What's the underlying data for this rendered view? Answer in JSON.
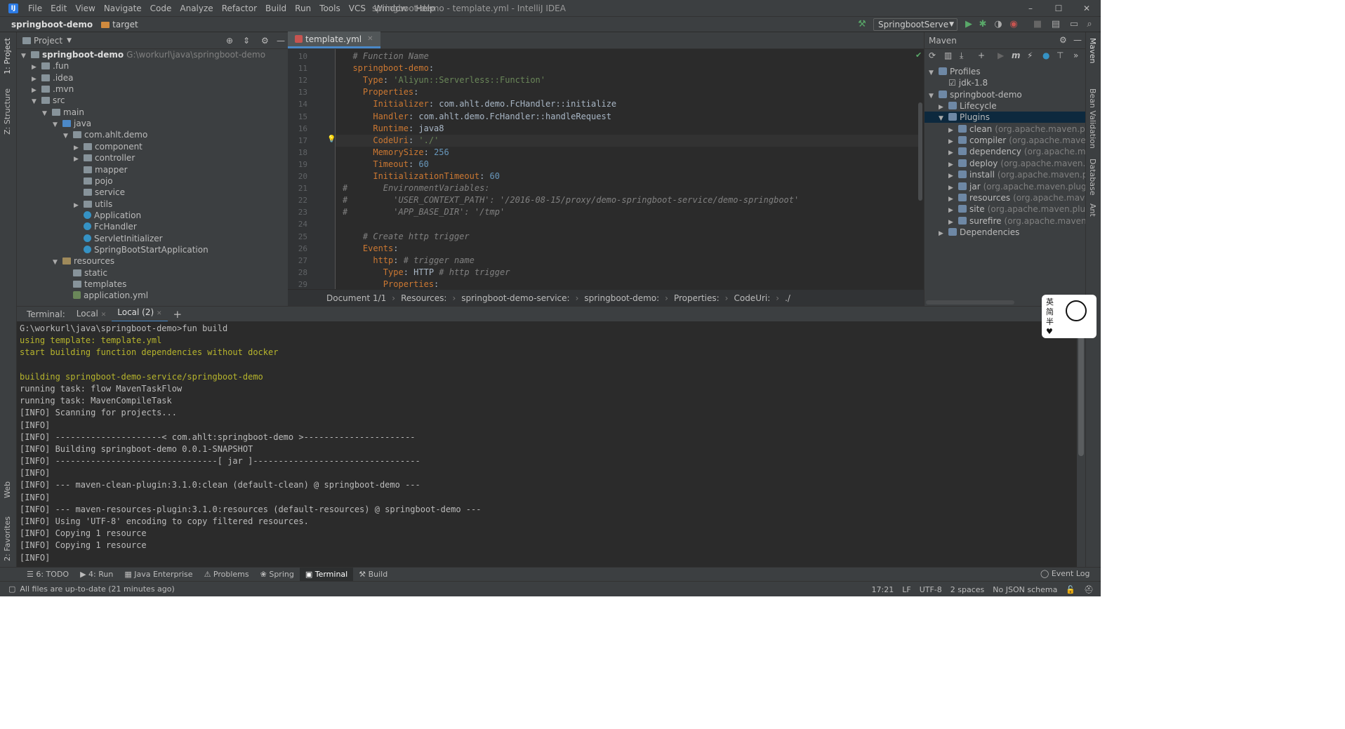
{
  "window": {
    "title": "springboot-demo - template.yml - IntelliJ IDEA",
    "logo": "IJ",
    "minimize": "–",
    "maximize": "☐",
    "close": "✕"
  },
  "menu": [
    "File",
    "Edit",
    "View",
    "Navigate",
    "Code",
    "Analyze",
    "Refactor",
    "Build",
    "Run",
    "Tools",
    "VCS",
    "Window",
    "Help"
  ],
  "navbar": {
    "project": "springboot-demo",
    "folder": "target"
  },
  "run_config": "SpringbootServe",
  "left_strip": {
    "project_tab": "1: Project",
    "structure_tab": "Z: Structure",
    "web_tab": "Web",
    "favorites_tab": "2: Favorites"
  },
  "right_strip": {
    "maven_tab": "Maven",
    "bean_tab": "Bean Validation",
    "db_tab": "Database",
    "ant_tab": "Ant"
  },
  "project_panel": {
    "title": "Project",
    "tree": [
      {
        "label": "springboot-demo",
        "hint": "G:\\workurl\\java\\springboot-demo",
        "icon": "folder",
        "arrow": "▼",
        "bold": true
      },
      {
        "label": ".fun",
        "icon": "folder",
        "arrow": "▶"
      },
      {
        "label": ".idea",
        "icon": "folder",
        "arrow": "▶"
      },
      {
        "label": ".mvn",
        "icon": "folder",
        "arrow": "▶"
      },
      {
        "label": "src",
        "icon": "folder",
        "arrow": "▼"
      },
      {
        "label": "main",
        "icon": "folder",
        "arrow": "▼"
      },
      {
        "label": "java",
        "icon": "src-folder",
        "arrow": "▼"
      },
      {
        "label": "com.ahlt.demo",
        "icon": "folder",
        "arrow": "▼"
      },
      {
        "label": "component",
        "icon": "folder",
        "arrow": "▶"
      },
      {
        "label": "controller",
        "icon": "folder",
        "arrow": "▶"
      },
      {
        "label": "mapper",
        "icon": "folder",
        "arrow": ""
      },
      {
        "label": "pojo",
        "icon": "folder",
        "arrow": ""
      },
      {
        "label": "service",
        "icon": "folder",
        "arrow": ""
      },
      {
        "label": "utils",
        "icon": "folder",
        "arrow": "▶"
      },
      {
        "label": "Application",
        "icon": "class",
        "arrow": ""
      },
      {
        "label": "FcHandler",
        "icon": "class",
        "arrow": ""
      },
      {
        "label": "ServletInitializer",
        "icon": "class",
        "arrow": ""
      },
      {
        "label": "SpringBootStartApplication",
        "icon": "class",
        "arrow": ""
      },
      {
        "label": "resources",
        "icon": "res-folder",
        "arrow": "▼"
      },
      {
        "label": "static",
        "icon": "folder",
        "arrow": ""
      },
      {
        "label": "templates",
        "icon": "folder",
        "arrow": ""
      },
      {
        "label": "application.yml",
        "icon": "yml",
        "arrow": ""
      }
    ]
  },
  "editor": {
    "tab": "template.yml",
    "lines": [
      {
        "n": "10",
        "t": "  # Function Name"
      },
      {
        "n": "11",
        "t": "  springboot-demo:"
      },
      {
        "n": "12",
        "t": "    Type: 'Aliyun::Serverless::Function'"
      },
      {
        "n": "13",
        "t": "    Properties:"
      },
      {
        "n": "14",
        "t": "      Initializer: com.ahlt.demo.FcHandler::initialize"
      },
      {
        "n": "15",
        "t": "      Handler: com.ahlt.demo.FcHandler::handleRequest"
      },
      {
        "n": "16",
        "t": "      Runtime: java8"
      },
      {
        "n": "17",
        "t": "      CodeUri: './'"
      },
      {
        "n": "18",
        "t": "      MemorySize: 256"
      },
      {
        "n": "19",
        "t": "      Timeout: 60"
      },
      {
        "n": "20",
        "t": "      InitializationTimeout: 60"
      },
      {
        "n": "21",
        "t": "#       EnvironmentVariables:"
      },
      {
        "n": "22",
        "t": "#         'USER_CONTEXT_PATH': '/2016-08-15/proxy/demo-springboot-service/demo-springboot'"
      },
      {
        "n": "23",
        "t": "#         'APP_BASE_DIR': '/tmp'"
      },
      {
        "n": "24",
        "t": ""
      },
      {
        "n": "25",
        "t": "    # Create http trigger"
      },
      {
        "n": "26",
        "t": "    Events:"
      },
      {
        "n": "27",
        "t": "      http: # trigger name"
      },
      {
        "n": "28",
        "t": "        Type: HTTP # http trigger"
      },
      {
        "n": "29",
        "t": "        Properties:"
      }
    ],
    "breadcrumbs": [
      "Document 1/1",
      "Resources:",
      "springboot-demo-service:",
      "springboot-demo:",
      "Properties:",
      "CodeUri:",
      "./"
    ]
  },
  "maven": {
    "title": "Maven",
    "tree": [
      {
        "label": "Profiles",
        "hint": "",
        "arrow": "▼",
        "indent": 0
      },
      {
        "label": "jdk-1.8",
        "hint": "",
        "arrow": "",
        "indent": 1,
        "checkbox": true
      },
      {
        "label": "springboot-demo",
        "hint": "",
        "arrow": "▼",
        "indent": 0
      },
      {
        "label": "Lifecycle",
        "hint": "",
        "arrow": "▶",
        "indent": 1
      },
      {
        "label": "Plugins",
        "hint": "",
        "arrow": "▼",
        "indent": 1,
        "selected": true
      },
      {
        "label": "clean",
        "hint": "(org.apache.maven.plugins:m",
        "arrow": "▶",
        "indent": 2
      },
      {
        "label": "compiler",
        "hint": "(org.apache.maven.plugin",
        "arrow": "▶",
        "indent": 2
      },
      {
        "label": "dependency",
        "hint": "(org.apache.maven.plu",
        "arrow": "▶",
        "indent": 2
      },
      {
        "label": "deploy",
        "hint": "(org.apache.maven.plugins:",
        "arrow": "▶",
        "indent": 2
      },
      {
        "label": "install",
        "hint": "(org.apache.maven.plugins:m",
        "arrow": "▶",
        "indent": 2
      },
      {
        "label": "jar",
        "hint": "(org.apache.maven.plugins:mave",
        "arrow": "▶",
        "indent": 2
      },
      {
        "label": "resources",
        "hint": "(org.apache.maven.plugi",
        "arrow": "▶",
        "indent": 2
      },
      {
        "label": "site",
        "hint": "(org.apache.maven.plugins:mav",
        "arrow": "▶",
        "indent": 2
      },
      {
        "label": "surefire",
        "hint": "(org.apache.maven.plugins:",
        "arrow": "▶",
        "indent": 2
      },
      {
        "label": "Dependencies",
        "hint": "",
        "arrow": "▶",
        "indent": 1
      }
    ]
  },
  "terminal": {
    "label": "Terminal:",
    "tabs": [
      "Local",
      "Local (2)"
    ],
    "add": "+",
    "lines": [
      {
        "t": "G:\\workurl\\java\\springboot-demo>fun build",
        "c": ""
      },
      {
        "t": "using template: template.yml",
        "c": "yellow"
      },
      {
        "t": "start building function dependencies without docker",
        "c": "yellow"
      },
      {
        "t": "",
        "c": ""
      },
      {
        "t": "building springboot-demo-service/springboot-demo",
        "c": "yellow"
      },
      {
        "t": "running task: flow MavenTaskFlow",
        "c": ""
      },
      {
        "t": "running task: MavenCompileTask",
        "c": ""
      },
      {
        "t": "[INFO] Scanning for projects...",
        "c": ""
      },
      {
        "t": "[INFO]",
        "c": ""
      },
      {
        "t": "[INFO] ---------------------< com.ahlt:springboot-demo >----------------------",
        "c": ""
      },
      {
        "t": "[INFO] Building springboot-demo 0.0.1-SNAPSHOT",
        "c": ""
      },
      {
        "t": "[INFO] --------------------------------[ jar ]---------------------------------",
        "c": ""
      },
      {
        "t": "[INFO]",
        "c": ""
      },
      {
        "t": "[INFO] --- maven-clean-plugin:3.1.0:clean (default-clean) @ springboot-demo ---",
        "c": ""
      },
      {
        "t": "[INFO]",
        "c": ""
      },
      {
        "t": "[INFO] --- maven-resources-plugin:3.1.0:resources (default-resources) @ springboot-demo ---",
        "c": ""
      },
      {
        "t": "[INFO] Using 'UTF-8' encoding to copy filtered resources.",
        "c": ""
      },
      {
        "t": "[INFO] Copying 1 resource",
        "c": ""
      },
      {
        "t": "[INFO] Copying 1 resource",
        "c": ""
      },
      {
        "t": "[INFO]",
        "c": ""
      }
    ]
  },
  "bottom_tools": [
    "6: TODO",
    "4: Run",
    "Java Enterprise",
    "Problems",
    "Spring",
    "Terminal",
    "Build"
  ],
  "event_log": "Event Log",
  "status": {
    "message": "All files are up-to-date (21 minutes ago)",
    "position": "17:21",
    "line_sep": "LF",
    "encoding": "UTF-8",
    "indent": "2 spaces",
    "schema": "No JSON schema"
  },
  "sticker": {
    "text1": "英",
    "text2": "简",
    "text3": "半"
  },
  "colors": {
    "accent": "#4a88c7",
    "selection": "#0d293e",
    "keyword": "#cc7832",
    "string": "#6a8759",
    "comment": "#808080",
    "number": "#6897bb",
    "terminal_yellow": "#b6b42c"
  }
}
